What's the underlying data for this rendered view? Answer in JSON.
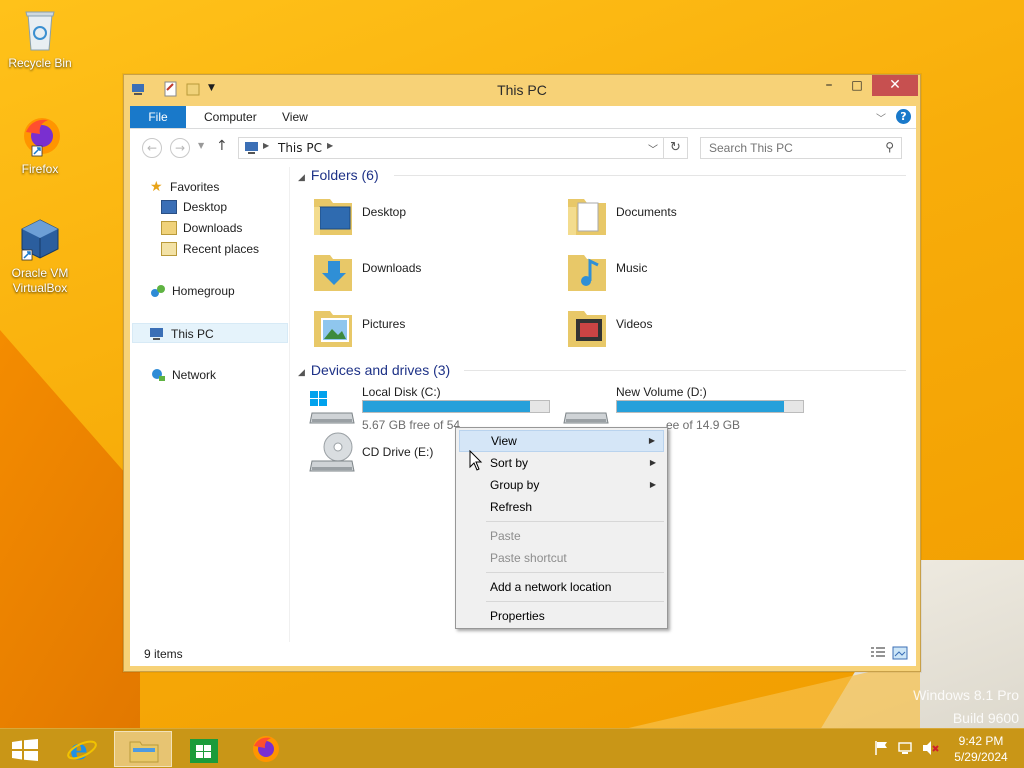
{
  "desktop": {
    "icons": [
      {
        "label": "Recycle Bin"
      },
      {
        "label": "Firefox"
      },
      {
        "label": "Oracle VM VirtualBox"
      }
    ],
    "watermark": {
      "line1": "Windows 8.1 Pro",
      "line2": "Build 9600"
    }
  },
  "window": {
    "title": "This PC",
    "ribbon_tabs": [
      "File",
      "Computer",
      "View"
    ],
    "address": {
      "location": "This PC"
    },
    "search": {
      "placeholder": "Search This PC"
    }
  },
  "navpane": {
    "favorites": "Favorites",
    "favorite_items": [
      "Desktop",
      "Downloads",
      "Recent places"
    ],
    "homegroup": "Homegroup",
    "this_pc": "This PC",
    "network": "Network"
  },
  "folders": {
    "header": "Folders (6)",
    "items": [
      "Desktop",
      "Documents",
      "Downloads",
      "Music",
      "Pictures",
      "Videos"
    ]
  },
  "devices": {
    "header": "Devices and drives (3)",
    "drives": [
      {
        "name": "Local Disk (C:)",
        "free": "5.67 GB free of 54.",
        "used_fraction": 0.9
      },
      {
        "name": "New Volume (D:)",
        "free": "ee of 14.9 GB",
        "used_fraction": 0.9
      },
      {
        "name": "CD Drive (E:)"
      }
    ]
  },
  "status": {
    "count": "9 items"
  },
  "context_menu": {
    "items": [
      "View",
      "Sort by",
      "Group by",
      "Refresh",
      "Paste",
      "Paste shortcut",
      "Add a network location",
      "Properties"
    ]
  },
  "taskbar": {
    "time": "9:42 PM",
    "date": "5/29/2024"
  },
  "colors": {
    "accent": "#1979ca",
    "close": "#c75050",
    "drive_bar": "#26a0da",
    "taskbar": "#c99617"
  }
}
